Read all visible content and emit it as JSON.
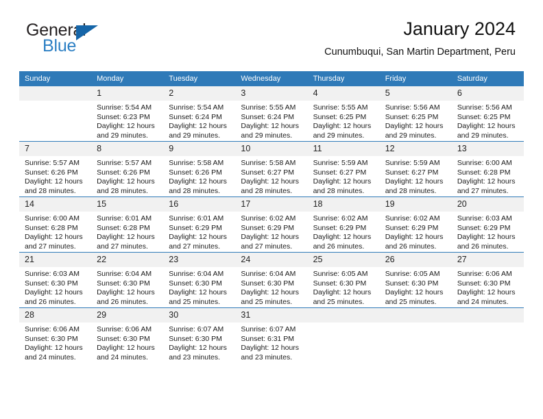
{
  "logo": {
    "word_one": "General",
    "word_two": "Blue",
    "flag_icon": "triangle-flag-icon",
    "brand_color": "#2c7fc4"
  },
  "header": {
    "title": "January 2024",
    "subtitle": "Cunumbuqui, San Martin Department, Peru"
  },
  "theme": {
    "header_blue": "#2f7ab8",
    "daynum_band": "#f1f1f1",
    "text": "#1a1a1a"
  },
  "calendar": {
    "weekday_headers": [
      "Sunday",
      "Monday",
      "Tuesday",
      "Wednesday",
      "Thursday",
      "Friday",
      "Saturday"
    ],
    "weeks": [
      [
        {
          "day": "",
          "sunrise": "",
          "sunset": "",
          "daylight_a": "",
          "daylight_b": "",
          "empty": true
        },
        {
          "day": "1",
          "sunrise": "Sunrise: 5:54 AM",
          "sunset": "Sunset: 6:23 PM",
          "daylight_a": "Daylight: 12 hours",
          "daylight_b": "and 29 minutes."
        },
        {
          "day": "2",
          "sunrise": "Sunrise: 5:54 AM",
          "sunset": "Sunset: 6:24 PM",
          "daylight_a": "Daylight: 12 hours",
          "daylight_b": "and 29 minutes."
        },
        {
          "day": "3",
          "sunrise": "Sunrise: 5:55 AM",
          "sunset": "Sunset: 6:24 PM",
          "daylight_a": "Daylight: 12 hours",
          "daylight_b": "and 29 minutes."
        },
        {
          "day": "4",
          "sunrise": "Sunrise: 5:55 AM",
          "sunset": "Sunset: 6:25 PM",
          "daylight_a": "Daylight: 12 hours",
          "daylight_b": "and 29 minutes."
        },
        {
          "day": "5",
          "sunrise": "Sunrise: 5:56 AM",
          "sunset": "Sunset: 6:25 PM",
          "daylight_a": "Daylight: 12 hours",
          "daylight_b": "and 29 minutes."
        },
        {
          "day": "6",
          "sunrise": "Sunrise: 5:56 AM",
          "sunset": "Sunset: 6:25 PM",
          "daylight_a": "Daylight: 12 hours",
          "daylight_b": "and 29 minutes."
        }
      ],
      [
        {
          "day": "7",
          "sunrise": "Sunrise: 5:57 AM",
          "sunset": "Sunset: 6:26 PM",
          "daylight_a": "Daylight: 12 hours",
          "daylight_b": "and 28 minutes."
        },
        {
          "day": "8",
          "sunrise": "Sunrise: 5:57 AM",
          "sunset": "Sunset: 6:26 PM",
          "daylight_a": "Daylight: 12 hours",
          "daylight_b": "and 28 minutes."
        },
        {
          "day": "9",
          "sunrise": "Sunrise: 5:58 AM",
          "sunset": "Sunset: 6:26 PM",
          "daylight_a": "Daylight: 12 hours",
          "daylight_b": "and 28 minutes."
        },
        {
          "day": "10",
          "sunrise": "Sunrise: 5:58 AM",
          "sunset": "Sunset: 6:27 PM",
          "daylight_a": "Daylight: 12 hours",
          "daylight_b": "and 28 minutes."
        },
        {
          "day": "11",
          "sunrise": "Sunrise: 5:59 AM",
          "sunset": "Sunset: 6:27 PM",
          "daylight_a": "Daylight: 12 hours",
          "daylight_b": "and 28 minutes."
        },
        {
          "day": "12",
          "sunrise": "Sunrise: 5:59 AM",
          "sunset": "Sunset: 6:27 PM",
          "daylight_a": "Daylight: 12 hours",
          "daylight_b": "and 28 minutes."
        },
        {
          "day": "13",
          "sunrise": "Sunrise: 6:00 AM",
          "sunset": "Sunset: 6:28 PM",
          "daylight_a": "Daylight: 12 hours",
          "daylight_b": "and 27 minutes."
        }
      ],
      [
        {
          "day": "14",
          "sunrise": "Sunrise: 6:00 AM",
          "sunset": "Sunset: 6:28 PM",
          "daylight_a": "Daylight: 12 hours",
          "daylight_b": "and 27 minutes."
        },
        {
          "day": "15",
          "sunrise": "Sunrise: 6:01 AM",
          "sunset": "Sunset: 6:28 PM",
          "daylight_a": "Daylight: 12 hours",
          "daylight_b": "and 27 minutes."
        },
        {
          "day": "16",
          "sunrise": "Sunrise: 6:01 AM",
          "sunset": "Sunset: 6:29 PM",
          "daylight_a": "Daylight: 12 hours",
          "daylight_b": "and 27 minutes."
        },
        {
          "day": "17",
          "sunrise": "Sunrise: 6:02 AM",
          "sunset": "Sunset: 6:29 PM",
          "daylight_a": "Daylight: 12 hours",
          "daylight_b": "and 27 minutes."
        },
        {
          "day": "18",
          "sunrise": "Sunrise: 6:02 AM",
          "sunset": "Sunset: 6:29 PM",
          "daylight_a": "Daylight: 12 hours",
          "daylight_b": "and 26 minutes."
        },
        {
          "day": "19",
          "sunrise": "Sunrise: 6:02 AM",
          "sunset": "Sunset: 6:29 PM",
          "daylight_a": "Daylight: 12 hours",
          "daylight_b": "and 26 minutes."
        },
        {
          "day": "20",
          "sunrise": "Sunrise: 6:03 AM",
          "sunset": "Sunset: 6:29 PM",
          "daylight_a": "Daylight: 12 hours",
          "daylight_b": "and 26 minutes."
        }
      ],
      [
        {
          "day": "21",
          "sunrise": "Sunrise: 6:03 AM",
          "sunset": "Sunset: 6:30 PM",
          "daylight_a": "Daylight: 12 hours",
          "daylight_b": "and 26 minutes."
        },
        {
          "day": "22",
          "sunrise": "Sunrise: 6:04 AM",
          "sunset": "Sunset: 6:30 PM",
          "daylight_a": "Daylight: 12 hours",
          "daylight_b": "and 26 minutes."
        },
        {
          "day": "23",
          "sunrise": "Sunrise: 6:04 AM",
          "sunset": "Sunset: 6:30 PM",
          "daylight_a": "Daylight: 12 hours",
          "daylight_b": "and 25 minutes."
        },
        {
          "day": "24",
          "sunrise": "Sunrise: 6:04 AM",
          "sunset": "Sunset: 6:30 PM",
          "daylight_a": "Daylight: 12 hours",
          "daylight_b": "and 25 minutes."
        },
        {
          "day": "25",
          "sunrise": "Sunrise: 6:05 AM",
          "sunset": "Sunset: 6:30 PM",
          "daylight_a": "Daylight: 12 hours",
          "daylight_b": "and 25 minutes."
        },
        {
          "day": "26",
          "sunrise": "Sunrise: 6:05 AM",
          "sunset": "Sunset: 6:30 PM",
          "daylight_a": "Daylight: 12 hours",
          "daylight_b": "and 25 minutes."
        },
        {
          "day": "27",
          "sunrise": "Sunrise: 6:06 AM",
          "sunset": "Sunset: 6:30 PM",
          "daylight_a": "Daylight: 12 hours",
          "daylight_b": "and 24 minutes."
        }
      ],
      [
        {
          "day": "28",
          "sunrise": "Sunrise: 6:06 AM",
          "sunset": "Sunset: 6:30 PM",
          "daylight_a": "Daylight: 12 hours",
          "daylight_b": "and 24 minutes."
        },
        {
          "day": "29",
          "sunrise": "Sunrise: 6:06 AM",
          "sunset": "Sunset: 6:30 PM",
          "daylight_a": "Daylight: 12 hours",
          "daylight_b": "and 24 minutes."
        },
        {
          "day": "30",
          "sunrise": "Sunrise: 6:07 AM",
          "sunset": "Sunset: 6:30 PM",
          "daylight_a": "Daylight: 12 hours",
          "daylight_b": "and 23 minutes."
        },
        {
          "day": "31",
          "sunrise": "Sunrise: 6:07 AM",
          "sunset": "Sunset: 6:31 PM",
          "daylight_a": "Daylight: 12 hours",
          "daylight_b": "and 23 minutes."
        },
        {
          "day": "",
          "sunrise": "",
          "sunset": "",
          "daylight_a": "",
          "daylight_b": "",
          "empty": true
        },
        {
          "day": "",
          "sunrise": "",
          "sunset": "",
          "daylight_a": "",
          "daylight_b": "",
          "empty": true
        },
        {
          "day": "",
          "sunrise": "",
          "sunset": "",
          "daylight_a": "",
          "daylight_b": "",
          "empty": true
        }
      ]
    ]
  }
}
